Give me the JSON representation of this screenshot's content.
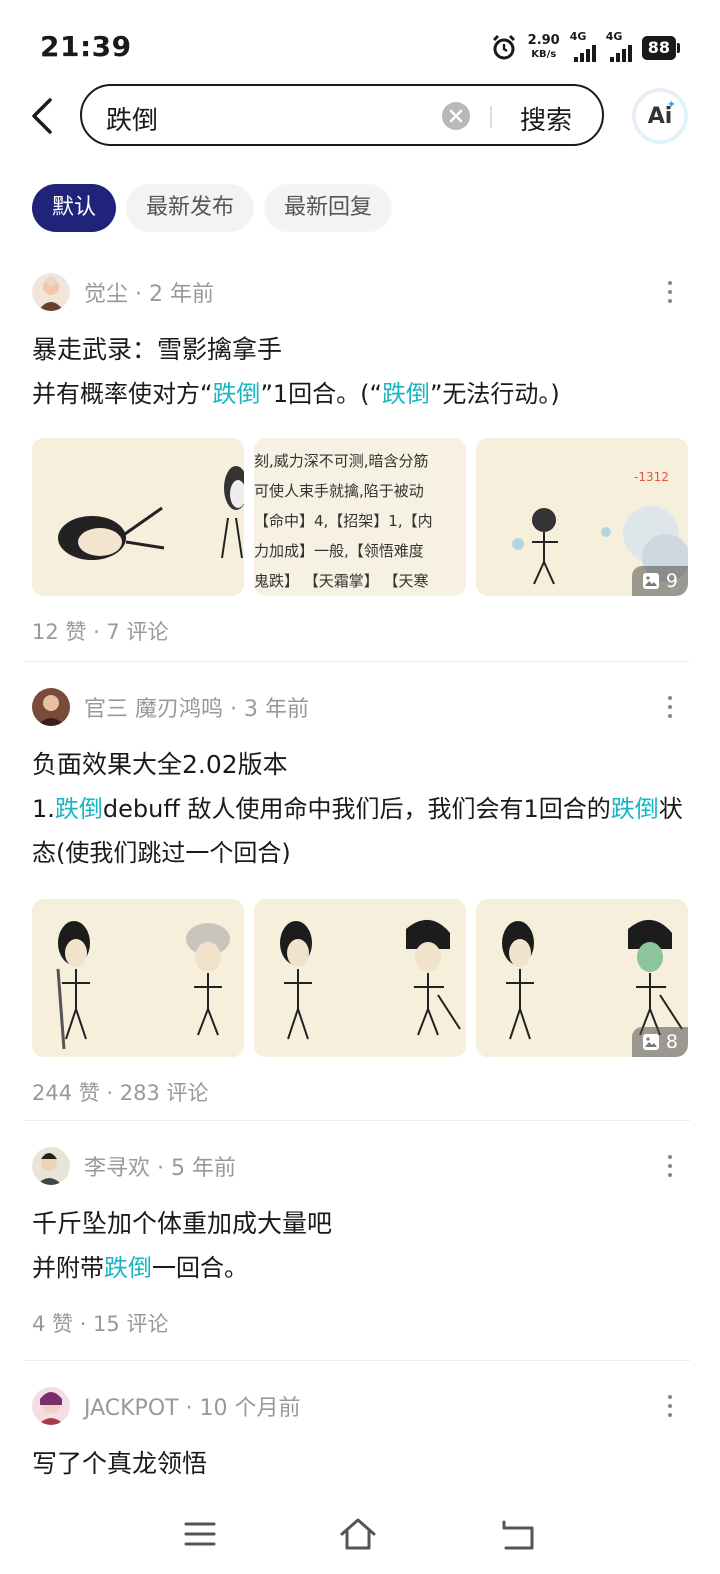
{
  "status": {
    "time": "21:39",
    "speed_value": "2.90",
    "speed_unit": "KB/s",
    "sim1": "4G",
    "sim2": "4G",
    "battery": "88"
  },
  "search": {
    "query": "跌倒",
    "button": "搜索",
    "ai_label": "Ai"
  },
  "filters": [
    "默认",
    "最新发布",
    "最新回复"
  ],
  "posts": [
    {
      "author_meta": "觉尘 · 2 年前",
      "title": "暴走武录：雪影擒拿手",
      "body": [
        {
          "t": "并有概率使对方“"
        },
        {
          "t": "跌倒",
          "hl": true
        },
        {
          "t": "”1回合。(“"
        },
        {
          "t": "跌倒",
          "hl": true
        },
        {
          "t": "”无法行动。)"
        }
      ],
      "image_text_lines": [
        "刻,威力深不可测,暗含分筋",
        "可使人束手就擒,陷于被动",
        "【命中】4,【招架】1,【内",
        "力加成】一般,【领悟难度",
        "鬼跌】 【天霜掌】 【天寒"
      ],
      "image_damage": "-1312",
      "image_count": "9",
      "stats": "12 赞 · 7 评论"
    },
    {
      "author_meta": "官三 魔刃鸿鸣 · 3 年前",
      "title": "负面效果大全2.02版本",
      "body": [
        {
          "t": "1."
        },
        {
          "t": "跌倒",
          "hl": true
        },
        {
          "t": "debuff 敌人使用命中我们后，我们会有1回合的"
        },
        {
          "t": "跌倒",
          "hl": true
        },
        {
          "t": "状态(使我们跳过一个回合)"
        }
      ],
      "image_count": "8",
      "stats": "244 赞 · 283 评论"
    },
    {
      "author_meta": "李寻欢 · 5 年前",
      "title": "千斤坠加个体重加成大量吧",
      "body": [
        {
          "t": "并附带"
        },
        {
          "t": "跌倒",
          "hl": true
        },
        {
          "t": "一回合。"
        }
      ],
      "stats": "4 赞 · 15 评论"
    },
    {
      "author_meta": "JACKPOT · 10 个月前",
      "title": "写了个真龙领悟"
    }
  ],
  "nav": {
    "icons": [
      "menu-icon",
      "home-icon",
      "back-icon"
    ]
  },
  "colors": {
    "accent_chip": "#1f237a",
    "highlight": "#17b7c2",
    "meta_gray": "#999999"
  }
}
